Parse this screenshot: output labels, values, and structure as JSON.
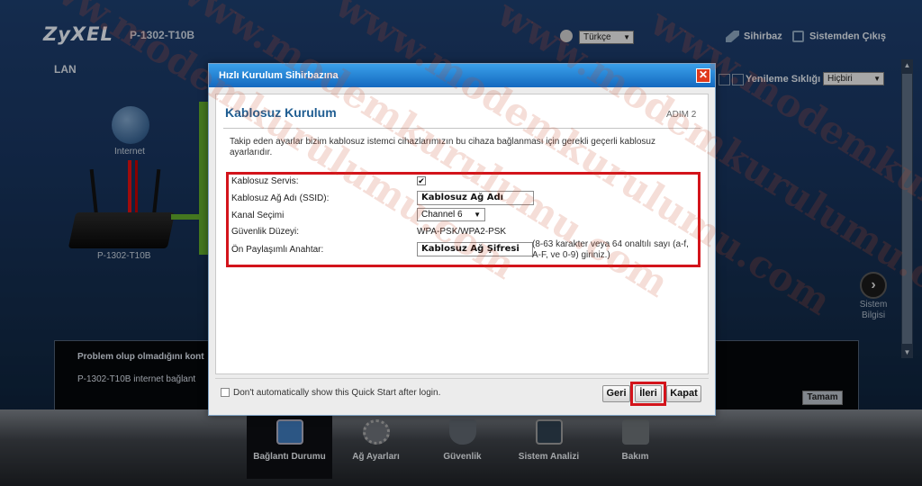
{
  "header": {
    "brand": "ZyXEL",
    "model": "P-1302-T10B",
    "language": "Türkçe",
    "wizard_link": "Sihirbaz",
    "logout_link": "Sistemden Çıkış"
  },
  "page": {
    "section": "LAN",
    "refresh_label": "Yenileme Sıklığı",
    "refresh_value": "Hiçbiri"
  },
  "diagram": {
    "internet_label": "Internet",
    "router_label": "P-1302-T10B"
  },
  "side_nav": {
    "next_label": "Sistem Bilgisi"
  },
  "status_panel": {
    "line1": "Problem olup olmadığını kont",
    "line2": "P-1302-T10B internet bağlant",
    "ok_button": "Tamam"
  },
  "bottom_nav": {
    "items": [
      {
        "label": "Bağlantı Durumu",
        "icon": "monitor-icon",
        "active": true
      },
      {
        "label": "Ağ Ayarları",
        "icon": "gear-icon",
        "active": false
      },
      {
        "label": "Güvenlik",
        "icon": "shield-icon",
        "active": false
      },
      {
        "label": "Sistem Analizi",
        "icon": "chart-icon",
        "active": false
      },
      {
        "label": "Bakım",
        "icon": "tools-icon",
        "active": false
      }
    ]
  },
  "modal": {
    "title": "Hızlı Kurulum Sihirbazına",
    "close_icon": "close-icon",
    "section_title": "Kablosuz Kurulum",
    "step": "ADIM 2",
    "description": "Takip eden ayarlar bizim kablosuz istemci cihazlarımızın bu cihaza bağlanması için gerekli geçerli kablosuz ayarlarıdır.",
    "fields": {
      "service_label": "Kablosuz Servis:",
      "service_checked": true,
      "ssid_label": "Kablosuz Ağ Adı (SSID):",
      "ssid_value": "Kablosuz Ağ Adı",
      "channel_label": "Kanal Seçimi",
      "channel_value": "Channel 6",
      "security_label": "Güvenlik Düzeyi:",
      "security_value": "WPA-PSK/WPA2-PSK",
      "psk_label": "Ön Paylaşımlı Anahtar:",
      "psk_value": "Kablosuz Ağ Şifresi",
      "psk_hint": "(8-63 karakter veya 64 onaltılı sayı (a-f, A-F, ve 0-9) giriniz.)"
    },
    "dont_show_label": "Don't automatically show this Quick Start after login.",
    "buttons": {
      "back": "Geri",
      "next": "İleri",
      "close": "Kapat"
    }
  },
  "watermark": {
    "text": "www.modemkurulumu.com"
  },
  "colors": {
    "highlight_red": "#d3141b",
    "header_blue": "#1469bf",
    "title_blue": "#1f5d91"
  }
}
